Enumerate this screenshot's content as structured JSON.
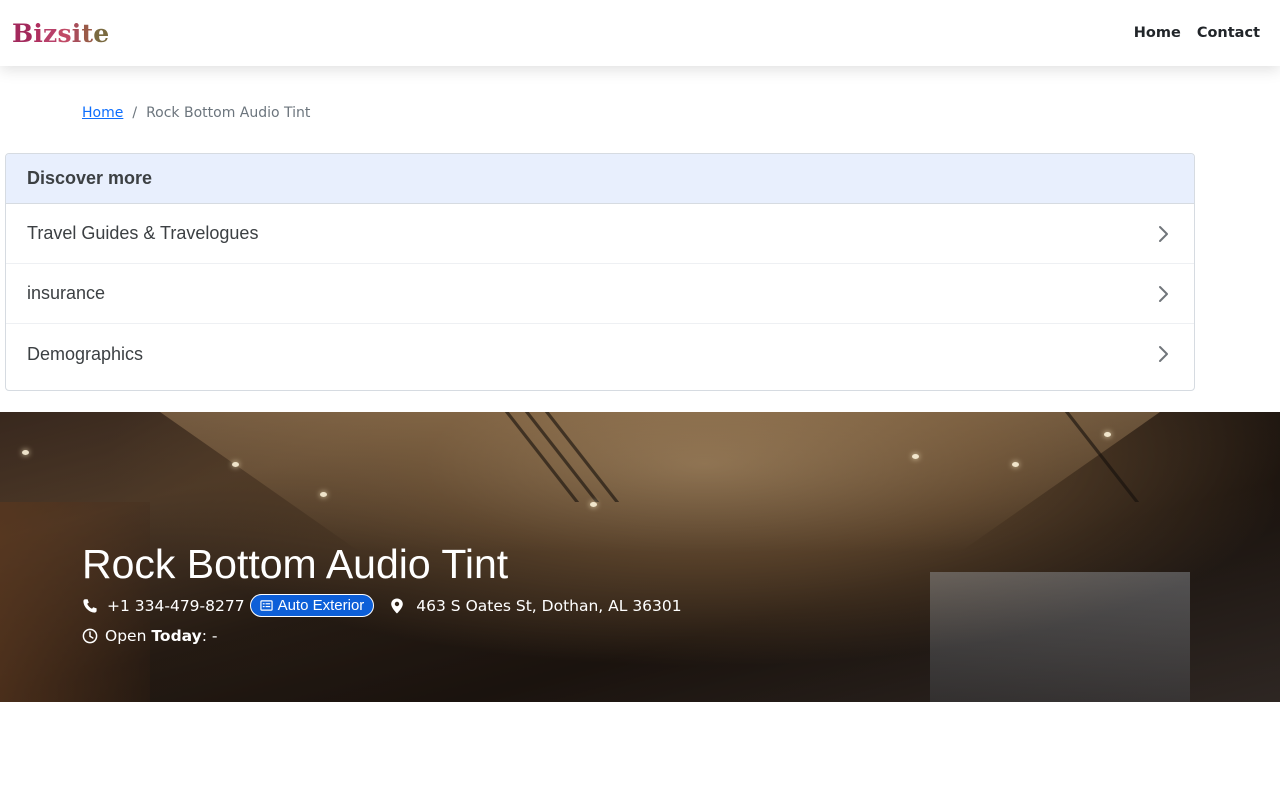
{
  "brand": {
    "name": "Bizsite"
  },
  "nav": {
    "home": "Home",
    "contact": "Contact"
  },
  "breadcrumb": {
    "home": "Home",
    "separator": "/",
    "current": "Rock Bottom Audio Tint"
  },
  "discover": {
    "title": "Discover more",
    "items": [
      {
        "label": "Travel Guides & Travelogues"
      },
      {
        "label": "insurance"
      },
      {
        "label": "Demographics"
      }
    ]
  },
  "business": {
    "name": "Rock Bottom Audio Tint",
    "phone": "+1 334-479-8277",
    "category": "Auto Exterior",
    "address": "463 S Oates St, Dothan, AL 36301",
    "hours_open": "Open",
    "hours_today": "Today",
    "hours_value": ": -"
  },
  "colors": {
    "badge": "#0d5fd8",
    "link": "#0d6efd",
    "discover_header": "#e8effd"
  }
}
